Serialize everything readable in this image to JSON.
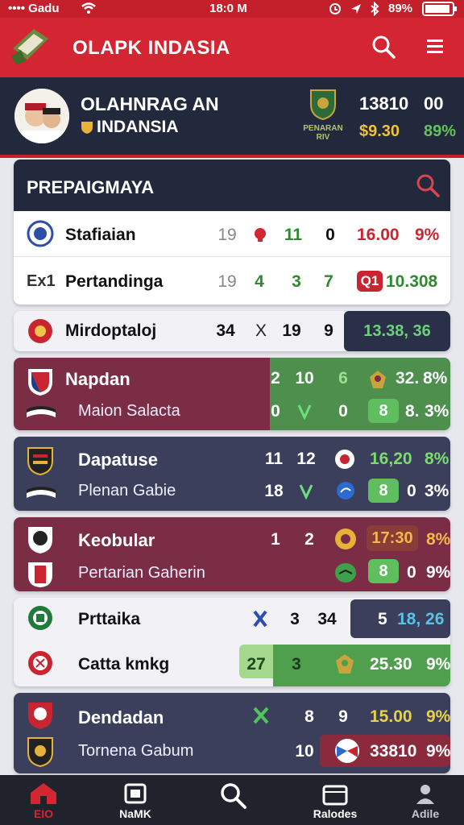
{
  "status": {
    "carrier": "•••• Gadu",
    "time": "18:0 M",
    "battery": "89%"
  },
  "app": {
    "title": "OLAPK INDASIA"
  },
  "profile": {
    "line1": "OLAHNRAG AN",
    "line2": "INDANSIA",
    "badge_label": "PENARAN RIV",
    "stat1": "13810",
    "stat2": "00",
    "stat3": "$9.30",
    "stat4": "89%"
  },
  "section": {
    "title": "PREPAIGMAYA"
  },
  "card_rows": [
    {
      "name": "Stafiaian",
      "a": "19",
      "b": "11",
      "c": "0",
      "score": "16.00",
      "pct": "9%"
    },
    {
      "prefix": "Ex1",
      "name": "Pertandinga",
      "a": "19",
      "b": "4",
      "c": "3",
      "d": "7",
      "tag": "Q1",
      "score": "10.308"
    }
  ],
  "row3": {
    "name": "Mirdoptaloj",
    "a": "34",
    "x": "X",
    "b": "19",
    "c": "9",
    "score": "13.38, 36"
  },
  "row4": {
    "name": "Napdan",
    "sub": "Maion Salacta",
    "a": "2",
    "b": "10",
    "c": "6",
    "score": "32.",
    "pct": "8%",
    "d": "0",
    "e": "0",
    "pill": "8",
    "n": "8.",
    "pct2": "3%"
  },
  "row5": {
    "name": "Dapatuse",
    "sub": "Plenan Gabie",
    "a": "11",
    "b": "12",
    "score": "16,20",
    "pct": "8%",
    "c": "18",
    "pill": "8",
    "n": "0",
    "pct2": "3%"
  },
  "row6": {
    "name": "Keobular",
    "sub": "Pertarian Gaherin",
    "a": "1",
    "b": "2",
    "score": "17:30",
    "pct": "8%",
    "pill": "8",
    "n": "0",
    "pct2": "9%"
  },
  "row7": {
    "name": "Prttaika",
    "sub": "Catta kmkg",
    "a": "3",
    "b": "34",
    "score": "5",
    "score2": "18, 26",
    "c": "27",
    "d": "3",
    "score3": "25.30",
    "pct": "9%"
  },
  "row8": {
    "name": "Dendadan",
    "sub": "Tornena Gabum",
    "a": "8",
    "b": "9",
    "score": "15.00",
    "pct": "9%",
    "c": "10",
    "score2": "33810",
    "pct2": "9%"
  },
  "tabs": [
    "EIO",
    "NaMK",
    "",
    "Ralodes",
    "Adile"
  ],
  "colors": {
    "red": "#d42632",
    "navy": "#22293c",
    "maroon": "#7b2d45",
    "slate": "#3b3f5b",
    "green": "#5aa64a"
  }
}
